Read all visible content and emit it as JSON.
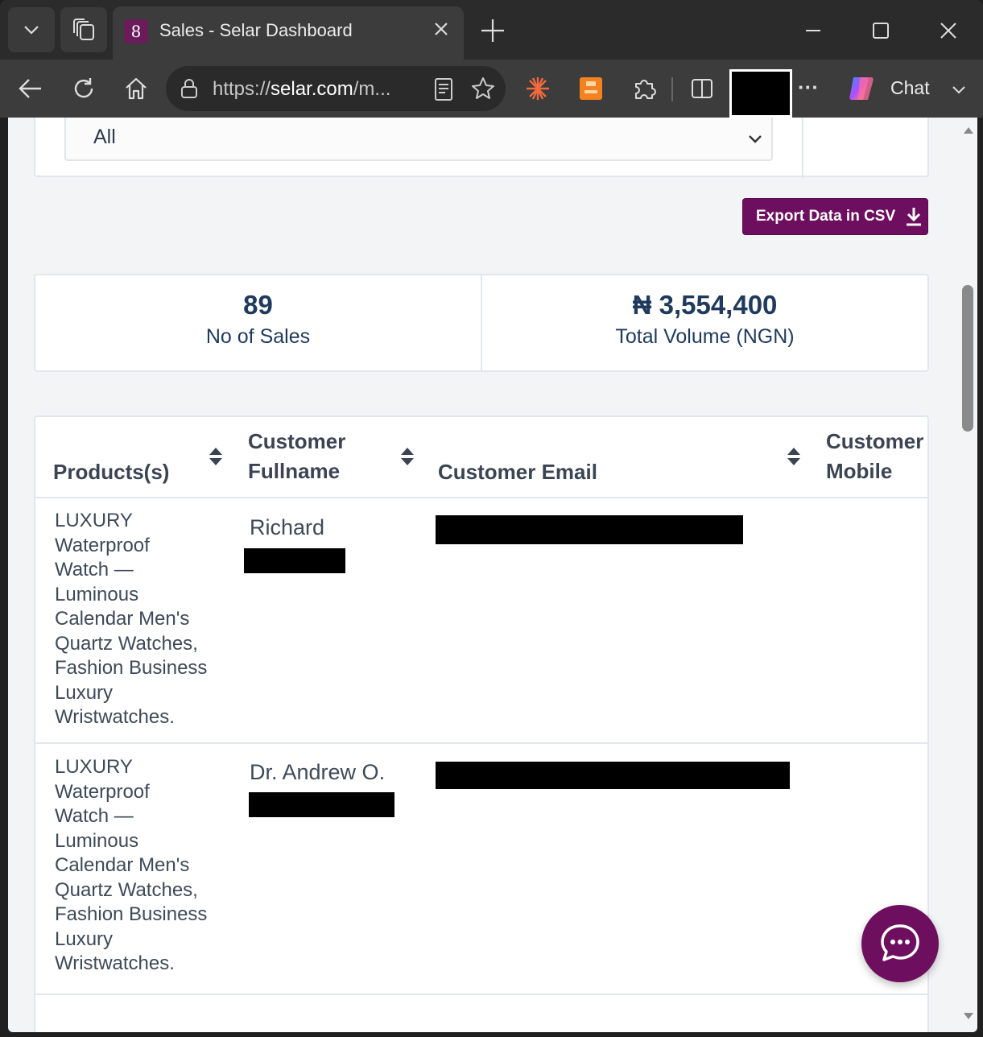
{
  "browser": {
    "tab_title": "Sales - Selar Dashboard",
    "favicon_glyph": "8",
    "url_prefix": "https://",
    "url_domain": "selar.com",
    "url_rest": "/m...",
    "chat_label": "Chat",
    "more_label": "···"
  },
  "filter": {
    "selected": "All"
  },
  "export_button": {
    "label": "Export Data in CSV"
  },
  "stats": {
    "sales_count": "89",
    "sales_label": "No of Sales",
    "volume_value": "₦ 3,554,400",
    "volume_label": "Total Volume (NGN)"
  },
  "table": {
    "headers": {
      "products": "Products(s)",
      "fullname_line1": "Customer",
      "fullname_line2": "Fullname",
      "email": "Customer Email",
      "mobile_line1": "Customer",
      "mobile_line2": "Mobile"
    },
    "rows": [
      {
        "product": [
          "LUXURY",
          "Waterproof",
          "Watch —",
          "Luminous",
          "Calendar Men's",
          "Quartz Watches,",
          "Fashion Business",
          "Luxury",
          "Wristwatches."
        ],
        "name": "Richard"
      },
      {
        "product": [
          "LUXURY",
          "Waterproof",
          "Watch —",
          "Luminous",
          "Calendar Men's",
          "Quartz Watches,",
          "Fashion Business",
          "Luxury",
          "Wristwatches."
        ],
        "name": "Dr. Andrew O."
      }
    ]
  },
  "colors": {
    "brand": "#6d0f5e",
    "stat_text": "#1f3a5c"
  }
}
